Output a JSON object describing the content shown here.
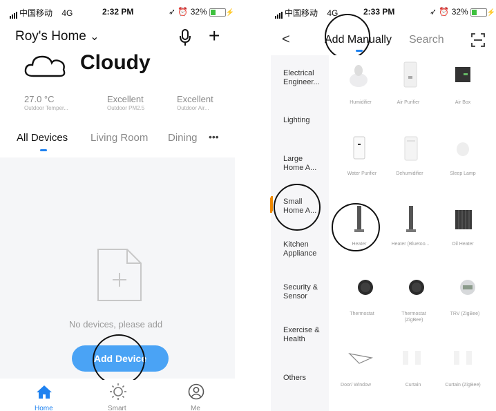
{
  "left_phone": {
    "status": {
      "carrier": "中国移动",
      "network": "4G",
      "time": "2:32 PM",
      "battery": "32%"
    },
    "header": {
      "home_name": "Roy's Home",
      "chevron": "⌄",
      "add_symbol": "+"
    },
    "weather": {
      "condition": "Cloudy"
    },
    "stats": [
      {
        "value": "27.0 °C",
        "label": "Outdoor Temper..."
      },
      {
        "value": "Excellent",
        "label": "Outdoor PM2.5"
      },
      {
        "value": "Excellent",
        "label": "Outdoor Air..."
      }
    ],
    "tabs": [
      "All Devices",
      "Living Room",
      "Dining"
    ],
    "more": "•••",
    "empty_message": "No devices, please add",
    "add_device_label": "Add Device",
    "nav": [
      "Home",
      "Smart",
      "Me"
    ]
  },
  "right_phone": {
    "status": {
      "carrier": "中国移动",
      "network": "4G",
      "time": "2:33 PM",
      "battery": "32%"
    },
    "header": {
      "back": "<",
      "tab_manual": "Add Manually",
      "tab_search": "Search"
    },
    "categories": [
      "Electrical Engineer...",
      "Lighting",
      "Large Home A...",
      "Small Home A...",
      "Kitchen Appliance",
      "Security & Sensor",
      "Exercise & Health",
      "Others"
    ],
    "devices": [
      [
        "Humidifier",
        "Air Purifier",
        "Air Box"
      ],
      [
        "Water Purifier",
        "Dehumidifier",
        "Sleep Lamp"
      ],
      [
        "Heater",
        "Heater (Bluetoo...",
        "Oil Heater"
      ],
      [
        "Thermostat",
        "Thermostat (ZigBee)",
        "TRV (ZigBee)"
      ],
      [
        "Door/ Window",
        "Curtain",
        "Curtain (ZigBee)"
      ]
    ]
  }
}
